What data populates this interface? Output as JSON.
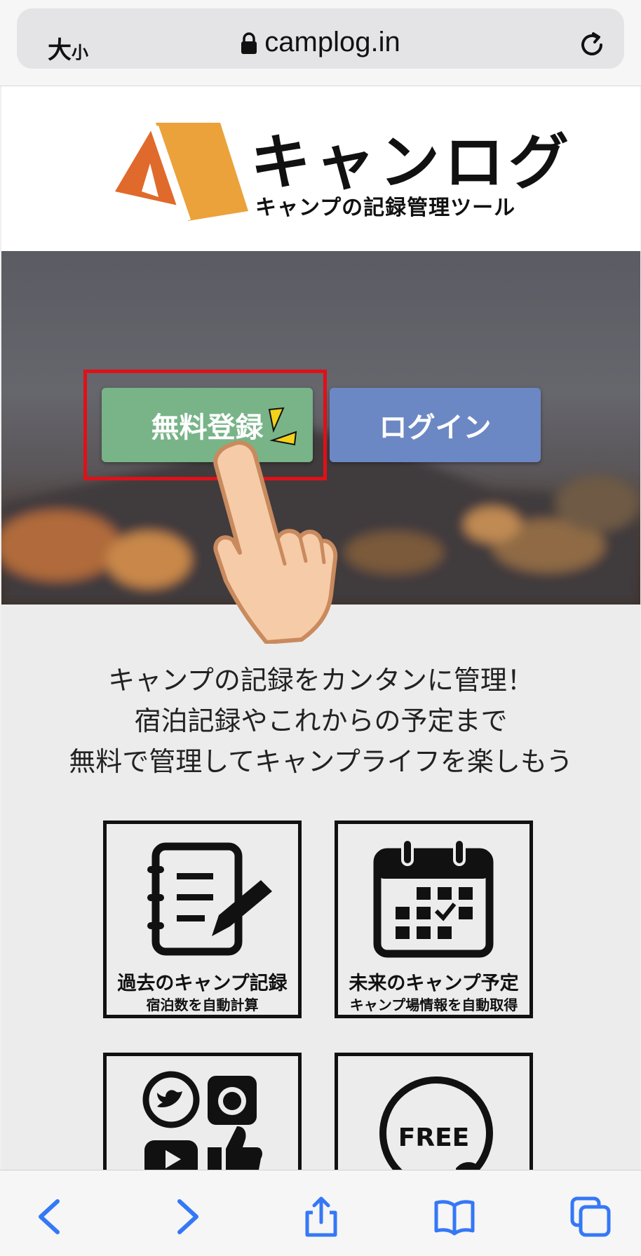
{
  "browser": {
    "text_size_label_large": "大",
    "text_size_label_small": "小",
    "url": "camplog.in",
    "icons": [
      "lock-icon",
      "reload-icon"
    ]
  },
  "header": {
    "logo_title": "キャンログ",
    "logo_subtitle": "キャンプの記録管理ツール"
  },
  "hero": {
    "register_button": "無料登録",
    "login_button": "ログイン"
  },
  "intro": {
    "lines": [
      "キャンプの記録をカンタンに管理！",
      "宿泊記録やこれからの予定まで",
      "無料で管理してキャンプライフを楽しもう"
    ]
  },
  "features": [
    {
      "title": "過去のキャンプ記録",
      "subtitle": "宿泊数を自動計算",
      "icon": "notebook-pencil-icon"
    },
    {
      "title": "未来のキャンプ予定",
      "subtitle": "キャンプ場情報を自動取得",
      "icon": "calendar-icon"
    },
    {
      "title": "",
      "subtitle": "",
      "icon": "social-media-icons"
    },
    {
      "title": "",
      "subtitle": "",
      "icon": "free-badge-icon",
      "badge_text": "FREE"
    }
  ],
  "toolbar": {
    "icons": [
      "back-icon",
      "forward-icon",
      "share-icon",
      "bookmarks-icon",
      "tabs-icon"
    ]
  },
  "colors": {
    "register": "#78b488",
    "login": "#6c88c4",
    "highlight": "#e01018",
    "ios_blue": "#3478f6"
  }
}
